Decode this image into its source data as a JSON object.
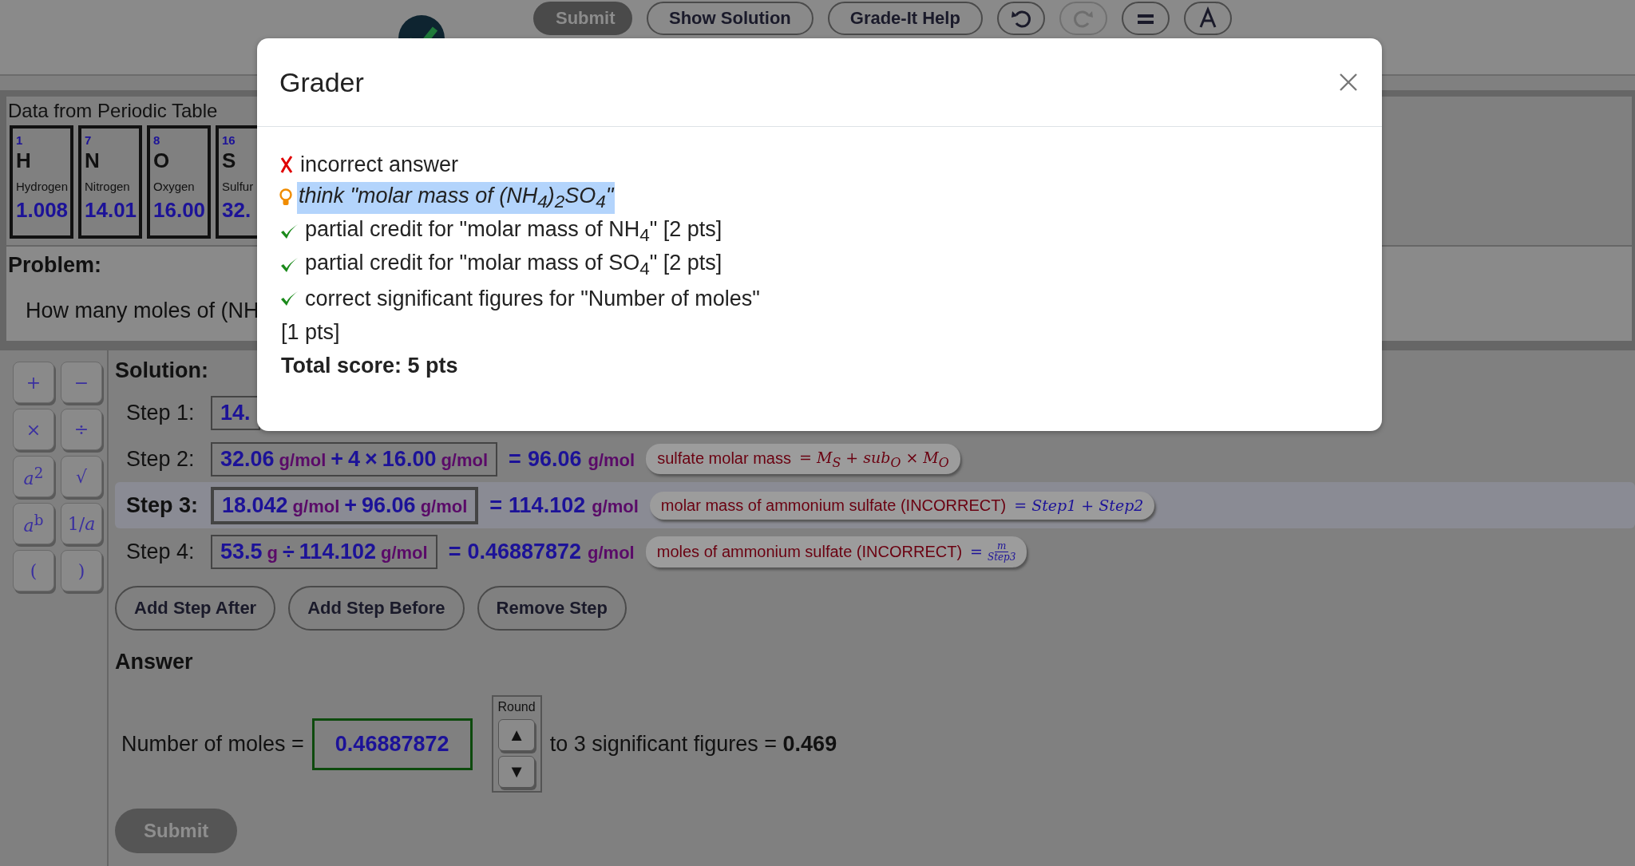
{
  "toolbar": {
    "buttons": [
      {
        "label": "Submit",
        "kind": "primary"
      },
      {
        "label": "Show Solution",
        "kind": "outline"
      },
      {
        "label": "Grade-It Help",
        "kind": "outline"
      }
    ],
    "icon_buttons": [
      {
        "kind": "undo",
        "disabled": false
      },
      {
        "kind": "redo",
        "disabled": true
      },
      {
        "kind": "menu",
        "disabled": false
      },
      {
        "kind": "text-size",
        "disabled": false
      }
    ]
  },
  "periodic_table": {
    "title": "Data from Periodic Table",
    "elements": [
      {
        "number": "1",
        "symbol": "H",
        "name": "Hydrogen",
        "mass": "1.008"
      },
      {
        "number": "7",
        "symbol": "N",
        "name": "Nitrogen",
        "mass": "14.01"
      },
      {
        "number": "8",
        "symbol": "O",
        "name": "Oxygen",
        "mass": "16.00"
      },
      {
        "number": "16",
        "symbol": "S",
        "name": "Sulfur",
        "mass": "32."
      }
    ]
  },
  "problem": {
    "label": "Problem:",
    "text": "How many moles of (NH"
  },
  "keypad": {
    "keys": [
      "+",
      "−",
      "×",
      "÷",
      "*a*$^{2}$",
      "√",
      "*a*$^{b}$",
      "1/*a*",
      "(",
      ")"
    ]
  },
  "solution": {
    "label": "Solution:",
    "steps": [
      {
        "label": "Step 1:",
        "selected": false,
        "expression": [
          {
            "kind": "num",
            "text": "14."
          }
        ]
      },
      {
        "label": "Step 2:",
        "selected": false,
        "expression": [
          {
            "kind": "num",
            "text": "32.06"
          },
          {
            "kind": "unit",
            "text": "g/mol"
          },
          {
            "kind": "op",
            "text": "+"
          },
          {
            "kind": "num",
            "text": "4"
          },
          {
            "kind": "op",
            "text": "×"
          },
          {
            "kind": "num",
            "text": "16.00"
          },
          {
            "kind": "unit",
            "text": "g/mol"
          }
        ],
        "result": {
          "equals": "=",
          "value": "96.06",
          "unit": "g/mol"
        },
        "comment": {
          "text": "sulfate molar mass",
          "formula": {
            "kind": "symbolic",
            "text": "= M$_{S}$ + sub$_{O}$ × M$_{O}$"
          }
        }
      },
      {
        "label": "Step 3:",
        "selected": true,
        "expression": [
          {
            "kind": "num",
            "text": "18.042"
          },
          {
            "kind": "unit",
            "text": "g/mol"
          },
          {
            "kind": "op",
            "text": "+"
          },
          {
            "kind": "num",
            "text": "96.06"
          },
          {
            "kind": "unit",
            "text": "g/mol"
          }
        ],
        "result": {
          "equals": "=",
          "value": "114.102",
          "unit": "g/mol"
        },
        "comment": {
          "text": "molar mass of ammonium sulfate (INCORRECT)",
          "formula": {
            "kind": "steps",
            "text": "= Step1 + Step2"
          }
        }
      },
      {
        "label": "Step 4:",
        "selected": false,
        "expression": [
          {
            "kind": "num",
            "text": "53.5"
          },
          {
            "kind": "unit",
            "text": "g"
          },
          {
            "kind": "op",
            "text": "÷"
          },
          {
            "kind": "num",
            "text": "114.102"
          },
          {
            "kind": "unit",
            "text": "g/mol"
          }
        ],
        "result": {
          "equals": "=",
          "value": "0.46887872",
          "unit": "g/mol"
        },
        "comment": {
          "text": "moles of ammonium sulfate (INCORRECT)",
          "formula": {
            "kind": "fraction",
            "prefix": "=",
            "numerator": "m",
            "denominator": "Step3"
          }
        }
      }
    ],
    "step_buttons": [
      "Add Step After",
      "Add Step Before",
      "Remove Step"
    ]
  },
  "answer": {
    "heading": "Answer",
    "label": "Number of moles =",
    "value": "0.46887872",
    "round_label": "Round",
    "round_up": "▲",
    "round_down": "▼",
    "suffix": "to 3 significant figures =",
    "rounded": "0.469",
    "submit": {
      "label": "Submit",
      "disabled": true
    }
  },
  "dialog": {
    "title": "Grader",
    "lines": [
      {
        "kind": "wrong",
        "text": "incorrect answer",
        "highlighted": false
      },
      {
        "kind": "hint",
        "text": "think \"molar mass of (NH$_{4}$)$_{2}$SO$_{4}$\"",
        "highlighted": true
      },
      {
        "kind": "right",
        "text": "partial credit for \"molar mass of NH$_{4}$\" [2 pts]",
        "highlighted": false
      },
      {
        "kind": "right",
        "text": "partial credit for \"molar mass of SO$_{4}$\" [2 pts]",
        "highlighted": false
      },
      {
        "kind": "right",
        "text": "correct significant figures for \"Number of moles\"",
        "highlighted": false
      },
      {
        "kind": "plain",
        "text": "[1 pts]",
        "highlighted": false
      },
      {
        "kind": "total",
        "text": "Total score: 5 pts",
        "highlighted": false
      }
    ]
  }
}
